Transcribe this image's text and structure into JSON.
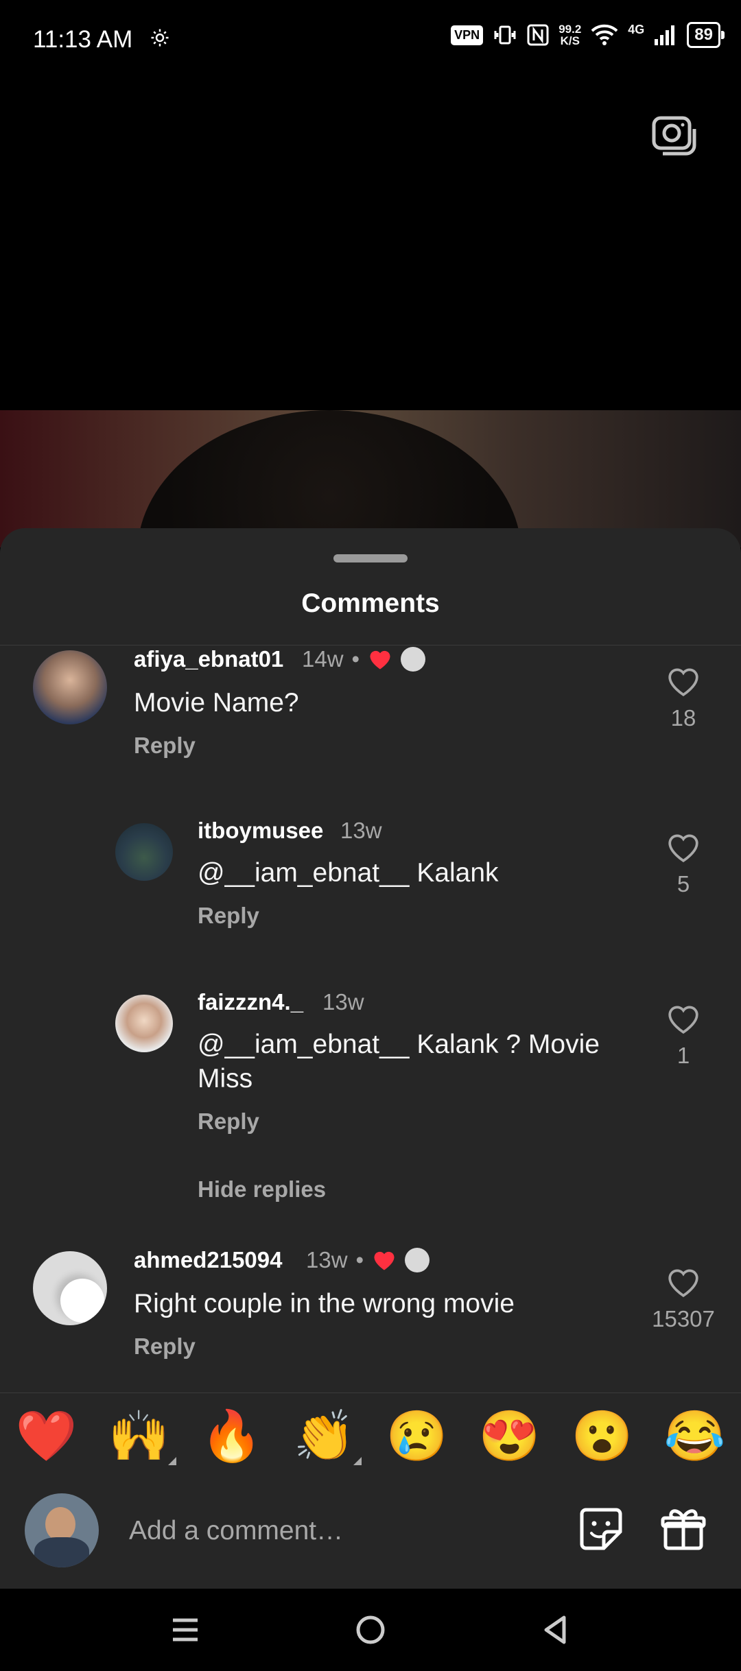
{
  "status_bar": {
    "time": "11:13 AM",
    "vpn": "VPN",
    "net_speed_value": "99.2",
    "net_speed_unit": "K/S",
    "network_type": "4G",
    "battery": "89"
  },
  "sheet": {
    "title": "Comments"
  },
  "comments": [
    {
      "username": "afiya_ebnat01",
      "time": "14w",
      "text": "Movie Name?",
      "reply_label": "Reply",
      "likes": "18",
      "liked_by_creator": true
    },
    {
      "username": "itboymusee",
      "time": "13w",
      "text": "@__iam_ebnat__ Kalank",
      "reply_label": "Reply",
      "likes": "5"
    },
    {
      "username": "faizzzn4._",
      "time": "13w",
      "text": "@__iam_ebnat__  Kalank ? Movie Miss",
      "reply_label": "Reply",
      "likes": "1"
    },
    {
      "username": "ahmed215094",
      "time": "13w",
      "text": "Right couple in the wrong movie",
      "reply_label": "Reply",
      "likes": "15307",
      "liked_by_creator": true
    }
  ],
  "hide_replies_label": "Hide replies",
  "quick_reactions": [
    "❤️",
    "🙌",
    "🔥",
    "👏",
    "😢",
    "😍",
    "😮",
    "😂"
  ],
  "composer": {
    "placeholder": "Add a comment…"
  },
  "icons": {
    "camera": "camera-icon",
    "heart": "heart-outline-icon",
    "sticker": "sticker-icon",
    "gift": "gift-icon",
    "nav_menu": "menu-icon",
    "nav_home": "home-circle-icon",
    "nav_back": "back-triangle-icon"
  },
  "colors": {
    "sheet_bg": "#262626",
    "text_secondary": "#a8a8a8",
    "creator_heart": "#ff3040"
  }
}
